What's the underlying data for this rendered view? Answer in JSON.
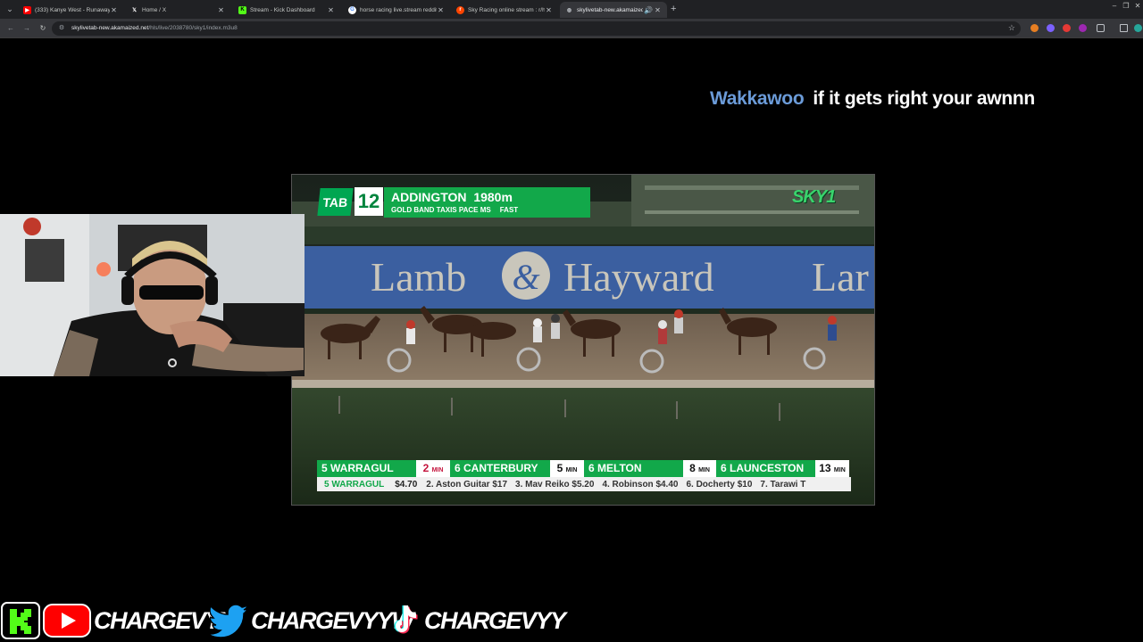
{
  "browser": {
    "tabs": [
      {
        "label": "(333) Kanye West - Runaway (L",
        "fav_color": "#ff0000",
        "fav_glyph": "▶"
      },
      {
        "label": "Home / X",
        "fav_color": "#202124",
        "fav_glyph": "X"
      },
      {
        "label": "Stream - Kick Dashboard",
        "fav_color": "#53fc18",
        "fav_glyph": "K"
      },
      {
        "label": "horse racing live.stream reddit",
        "fav_color": "#ffffff",
        "fav_glyph": "G"
      },
      {
        "label": "Sky Racing online stream : r/hor",
        "fav_color": "#ff4500",
        "fav_glyph": "r"
      },
      {
        "label": "skylivetab-new.akamaized.",
        "fav_color": "#5f6368",
        "fav_glyph": "◍"
      }
    ],
    "new_tab": "+",
    "url_host": "skylivetab-new.akamaized.net",
    "url_path": "/hls/live/2038780/sky1/index.m3u8",
    "window_controls": [
      "–",
      "❐",
      "✕"
    ]
  },
  "chat": {
    "username": "Wakkawoo",
    "message": "if it gets right your awnnn"
  },
  "broadcast": {
    "brand": "TAB",
    "race_number": "12",
    "venue": "ADDINGTON",
    "distance": "1980m",
    "race_name": "GOLD BAND TAXIS PACE MS",
    "track_condition": "FAST",
    "channel_logo": "SKY1",
    "sponsor_text": "Lamb & Hayward",
    "sponsor_partial": "Lar",
    "upcoming": [
      {
        "label": "5 WARRAGUL",
        "time": "2",
        "unit": "MIN",
        "hot": true
      },
      {
        "label": "6 CANTERBURY",
        "time": "5",
        "unit": "MIN",
        "hot": false
      },
      {
        "label": "6 MELTON",
        "time": "8",
        "unit": "MIN",
        "hot": false
      },
      {
        "label": "6 LAUNCESTON",
        "time": "13",
        "unit": "MIN",
        "hot": false
      }
    ],
    "odds_venue": "5  WARRAGUL",
    "odds_lead": "$4.70",
    "odds": [
      "2. Aston Guitar $17",
      "3. Mav Reiko $5.20",
      "4. Robinson $4.40",
      "6. Docherty $10",
      "7. Tarawi T"
    ]
  },
  "socials": [
    {
      "platform": "kick",
      "color": "#53fc18",
      "handle": "CHARGEVYY"
    },
    {
      "platform": "twitter",
      "color": "#1da1f2",
      "handle": "CHARGEVYYW"
    },
    {
      "platform": "tiktok",
      "color": "#ffffff",
      "handle": "CHARGEVYY"
    }
  ]
}
